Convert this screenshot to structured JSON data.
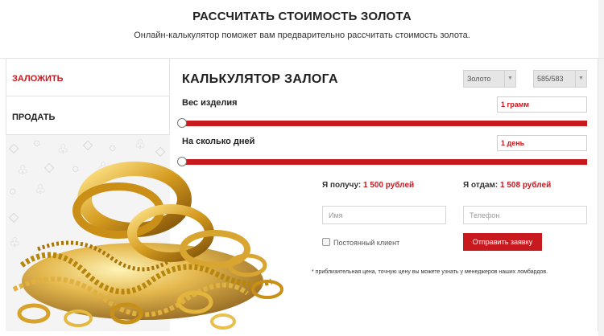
{
  "header": {
    "title": "РАССЧИТАТЬ СТОИМОСТЬ ЗОЛОТА",
    "subtitle": "Онлайн-калькулятор поможет вам предварительно рассчитать стоимость золота."
  },
  "sidebar": {
    "tabs": [
      {
        "label": "ЗАЛОЖИТЬ",
        "active": true
      },
      {
        "label": "ПРОДАТЬ",
        "active": false
      }
    ]
  },
  "calculator": {
    "title": "КАЛЬКУЛЯТОР ЗАЛОГА",
    "metal_select": "Золото",
    "purity_select": "585/583",
    "weight": {
      "label": "Вес изделия",
      "value": "1 грамм",
      "slider_fraction": 0
    },
    "days": {
      "label": "На сколько дней",
      "value": "1 день",
      "slider_fraction": 0
    },
    "receive": {
      "label": "Я получу:",
      "amount": "1 500 рублей"
    },
    "pay": {
      "label": "Я отдам:",
      "amount": "1 508 рублей"
    },
    "name_placeholder": "Имя",
    "phone_placeholder": "Телефон",
    "regular_client_label": "Постоянный клиент",
    "submit_label": "Отправить заявку",
    "footnote": "* приблизительная цена, точную цену вы можете узнать у менеджеров наших ломбардов."
  },
  "colors": {
    "accent": "#c8191f",
    "border": "#e2e2e2",
    "pattern_bg": "#f4f4f4",
    "gold": "#d4a017"
  },
  "icons": {
    "dropdown": "chevron-down-icon",
    "pattern": [
      "diamond-icon",
      "ring-icon",
      "clover-icon"
    ]
  }
}
